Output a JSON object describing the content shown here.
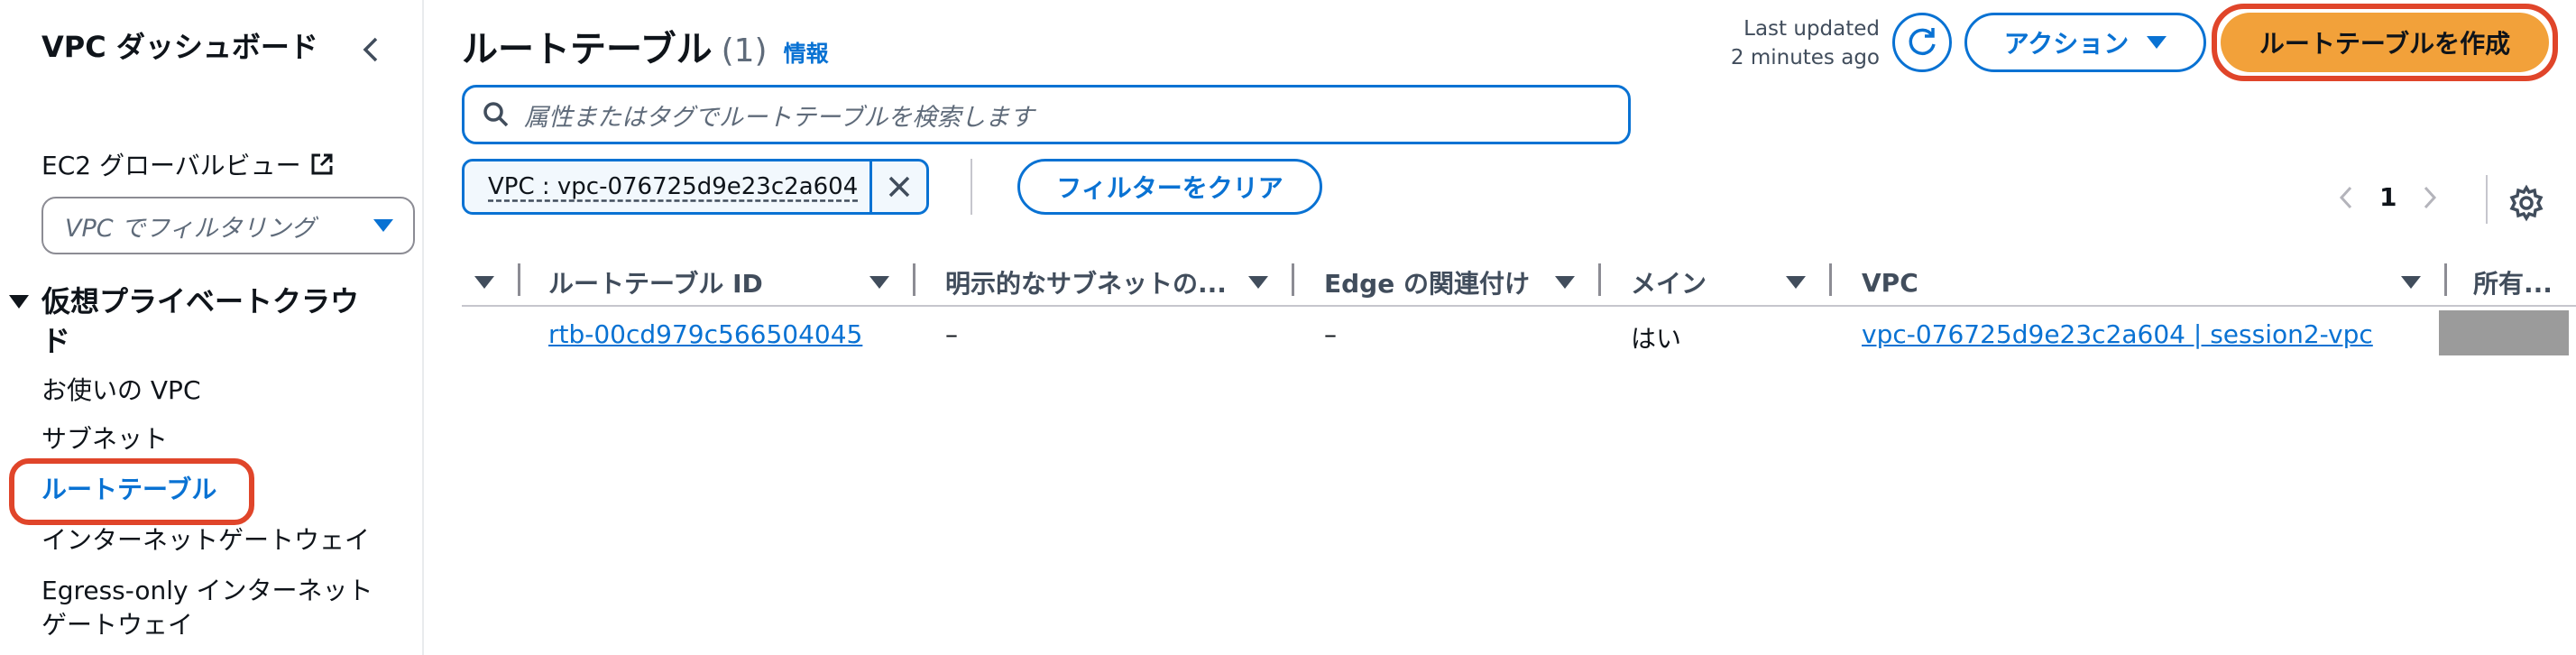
{
  "sidebar": {
    "title": "VPC ダッシュボード",
    "ec2_global_view": "EC2 グローバルビュー",
    "filter_placeholder": "VPC でフィルタリング",
    "section_title": "仮想プライベートクラウド",
    "items": [
      {
        "label": "お使いの VPC"
      },
      {
        "label": "サブネット"
      },
      {
        "label": "ルートテーブル"
      },
      {
        "label": "インターネットゲートウェイ"
      },
      {
        "label": "Egress-only インターネット\nゲートウェイ"
      }
    ]
  },
  "header": {
    "title": "ルートテーブル",
    "count": "(1)",
    "info_link": "情報",
    "last_updated": "Last updated\n2 minutes ago",
    "actions_label": "アクション",
    "create_label": "ルートテーブルを作成"
  },
  "search": {
    "placeholder": "属性またはタグでルートテーブルを検索します"
  },
  "filter": {
    "token": "VPC : vpc-076725d9e23c2a604",
    "clear_label": "フィルターをクリア"
  },
  "pagination": {
    "page": "1"
  },
  "table": {
    "columns": [
      "ルートテーブル ID",
      "明示的なサブネットの...",
      "Edge の関連付け",
      "メイン",
      "VPC",
      "所有..."
    ],
    "rows": [
      {
        "id": "rtb-00cd979c566504045",
        "explicit_subnet": "–",
        "edge": "–",
        "main": "はい",
        "vpc": "vpc-076725d9e23c2a604 | session2-vpc"
      }
    ]
  },
  "colors": {
    "accent": "#0972d3",
    "primary_button": "#f2a13a",
    "highlight": "#e0452a"
  }
}
